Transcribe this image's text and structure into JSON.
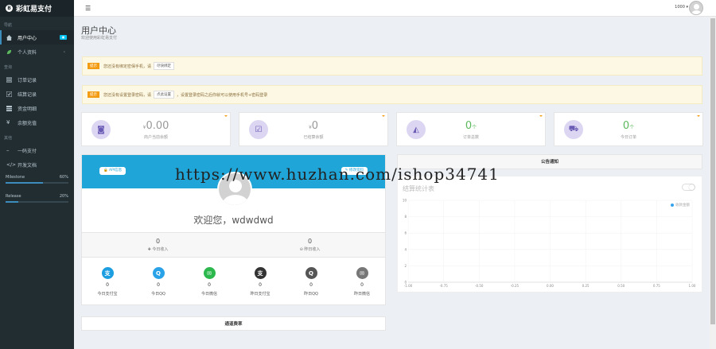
{
  "brand": {
    "logo": "B",
    "title": "彩虹易支付"
  },
  "sidebar": {
    "header_nav": "导航",
    "nav_items": [
      {
        "label": "用户中心",
        "icon": "home-icon",
        "badge": "",
        "active": true
      },
      {
        "label": "个人资料",
        "icon": "leaf-icon",
        "chevron": "‹",
        "active": false
      }
    ],
    "header_query": "查询",
    "query_items": [
      {
        "label": "订单记录",
        "icon": "list-icon"
      },
      {
        "label": "结算记录",
        "icon": "check-icon"
      },
      {
        "label": "资金明细",
        "icon": "table-icon"
      },
      {
        "label": "余额充值",
        "icon": "yen-icon"
      }
    ],
    "header_other": "其他",
    "other_items": [
      {
        "label": "一码支付",
        "icon": "minus-icon"
      },
      {
        "label": "开发文档",
        "icon": "code-icon"
      }
    ],
    "progress": [
      {
        "label": "Milestone",
        "value": "60%",
        "fraction": 0.6,
        "color": "#3c8dbc"
      },
      {
        "label": "Release",
        "value": "20%",
        "fraction": 0.2,
        "color": "#3c8dbc"
      }
    ]
  },
  "topbar": {
    "menu_icon": "menu-icon",
    "user_id": "1000 ▾"
  },
  "page": {
    "title": "用户中心",
    "subtitle": "欢迎使用彩虹易支付"
  },
  "alerts": [
    {
      "tag": "提示",
      "text_before": "您还没有绑定密保手机，请",
      "button": "尽快绑定",
      "text_after": ""
    },
    {
      "tag": "提示",
      "text_before": "您还没有设置登录密码，请",
      "button": "点此设置",
      "text_after": "，设置登录密码之后你就可以使用手机号+密码登录"
    }
  ],
  "stats": [
    {
      "prefix": "¥",
      "value": "0.00",
      "unit": "",
      "label": "商户当前余额",
      "icon": "money-icon",
      "gray": true
    },
    {
      "prefix": "¥",
      "value": "0",
      "unit": "",
      "label": "已结算余额",
      "icon": "checkbox-icon",
      "gray": true
    },
    {
      "prefix": "",
      "value": "0",
      "unit": "个",
      "label": "订单总数",
      "icon": "area-chart-icon",
      "gray": false
    },
    {
      "prefix": "",
      "value": "0",
      "unit": "个",
      "label": "今日订单",
      "icon": "cart-icon",
      "gray": false
    }
  ],
  "profile": {
    "api_button": "🔒 API信息",
    "edit_button": "✎ 修改资料",
    "welcome": "欢迎您，wdwdwd",
    "income": [
      {
        "value": "0",
        "label": "✚ 今日收入"
      },
      {
        "value": "0",
        "label": "⊖ 昨日收入"
      }
    ],
    "payments": [
      {
        "value": "0",
        "label": "今日支付宝",
        "icon": "alipay-icon",
        "glyph": "支",
        "color": "#1c9ee0"
      },
      {
        "value": "0",
        "label": "今日QQ",
        "icon": "qq-icon",
        "glyph": "Q",
        "color": "#2aa2e8"
      },
      {
        "value": "0",
        "label": "今日微信",
        "icon": "wechat-icon",
        "glyph": "✉",
        "color": "#2db84d"
      },
      {
        "value": "0",
        "label": "昨日支付宝",
        "icon": "alipay-icon",
        "glyph": "支",
        "color": "#333333"
      },
      {
        "value": "0",
        "label": "昨日QQ",
        "icon": "qq-icon",
        "glyph": "Q",
        "color": "#555555"
      },
      {
        "value": "0",
        "label": "昨日微信",
        "icon": "wechat-icon",
        "glyph": "✉",
        "color": "#777777"
      }
    ]
  },
  "quick_links": "通道费率",
  "notice_title": "公告通知",
  "watermark": "https://www.huzhan.com/ishop34741",
  "chart_data": {
    "type": "line",
    "title": "结算统计表",
    "legend": "收款金额",
    "x_ticks": [
      "-1.00",
      "-0.75",
      "-0.50",
      "-0.25",
      "0.00",
      "0.25",
      "0.50",
      "0.75",
      "1.00"
    ],
    "y_ticks": [
      "10",
      "8",
      "6",
      "4",
      "2",
      "0"
    ],
    "xlim": [
      -1,
      1
    ],
    "ylim": [
      0,
      10
    ],
    "series": [],
    "grid": true
  }
}
